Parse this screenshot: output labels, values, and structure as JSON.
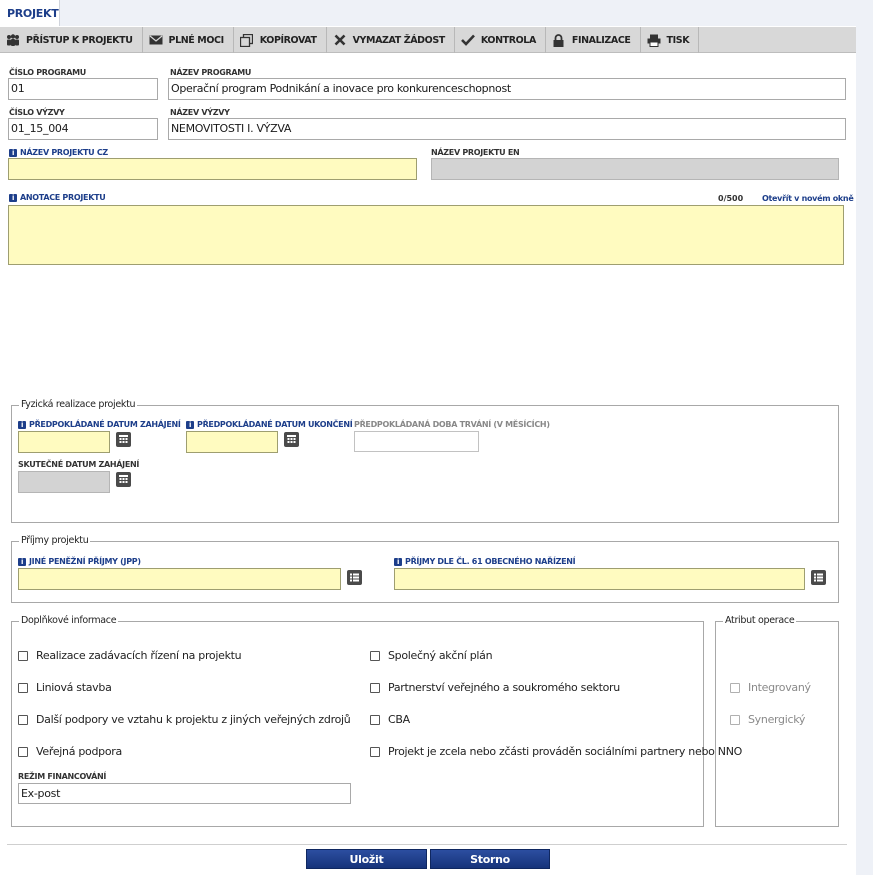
{
  "tab": {
    "label": "PROJEKT"
  },
  "toolbar": [
    {
      "label": "PŘÍSTUP K PROJEKTU",
      "icon": "people-icon"
    },
    {
      "label": "PLNÉ MOCI",
      "icon": "envelope-icon"
    },
    {
      "label": "KOPÍROVAT",
      "icon": "copy-icon"
    },
    {
      "label": "VYMAZAT ŽÁDOST",
      "icon": "close-icon"
    },
    {
      "label": "KONTROLA",
      "icon": "check-icon"
    },
    {
      "label": "FINALIZACE",
      "icon": "lock-icon"
    },
    {
      "label": "TISK",
      "icon": "printer-icon"
    }
  ],
  "fields": {
    "cislo_programu": {
      "label": "ČÍSLO PROGRAMU",
      "value": "01"
    },
    "nazev_programu": {
      "label": "NÁZEV PROGRAMU",
      "value": "Operační program Podnikání a inovace pro konkurenceschopnost"
    },
    "cislo_vyzvy": {
      "label": "ČÍSLO VÝZVY",
      "value": "01_15_004"
    },
    "nazev_vyzvy": {
      "label": "NÁZEV VÝZVY",
      "value": "NEMOVITOSTI I. VÝZVA"
    },
    "nazev_projektu_cz": {
      "label": "NÁZEV PROJEKTU CZ",
      "value": ""
    },
    "nazev_projektu_en": {
      "label": "NÁZEV PROJEKTU EN",
      "value": ""
    },
    "anotace": {
      "label": "ANOTACE PROJEKTU",
      "value": "",
      "counter": "0/500",
      "open_link": "Otevřít v novém okně"
    }
  },
  "fyzicka": {
    "legend": "Fyzická realizace projektu",
    "datum_zahajeni": "PŘEDPOKLÁDANÉ DATUM ZAHÁJENÍ",
    "datum_ukonceni": "PŘEDPOKLÁDANÉ DATUM UKONČENÍ",
    "doba_trvani": "PŘEDPOKLÁDANÁ DOBA TRVÁNÍ (V MĚSÍCÍCH)",
    "skutecne_zahajeni": "SKUTEČNÉ DATUM ZAHÁJENÍ"
  },
  "prijmy": {
    "legend": "Příjmy projektu",
    "jpp": "JINÉ PENĚŽNÍ PŘÍJMY (JPP)",
    "cl61": "PŘÍJMY DLE ČL. 61 OBECNÉHO NAŘÍZENÍ"
  },
  "doplnkove": {
    "legend": "Doplňkové informace",
    "left": [
      "Realizace zadávacích řízení na projektu",
      "Liniová stavba",
      "Další podpory ve vztahu k projektu z jiných veřejných zdrojů",
      "Veřejná podpora"
    ],
    "right": [
      "Společný akční plán",
      "Partnerství veřejného a soukromého sektoru",
      "CBA",
      "Projekt je zcela nebo zčásti prováděn sociálními partnery nebo NNO"
    ],
    "rezim_label": "REŽIM FINANCOVÁNÍ",
    "rezim_value": "Ex-post"
  },
  "atribut": {
    "legend": "Atribut operace",
    "items": [
      "Integrovaný",
      "Synergický"
    ]
  },
  "buttons": {
    "save": "Uložit",
    "cancel": "Storno"
  },
  "colors": {
    "accent": "#1d3e8a",
    "required_bg": "#fffbc0",
    "disabled_bg": "#d3d3d3"
  }
}
